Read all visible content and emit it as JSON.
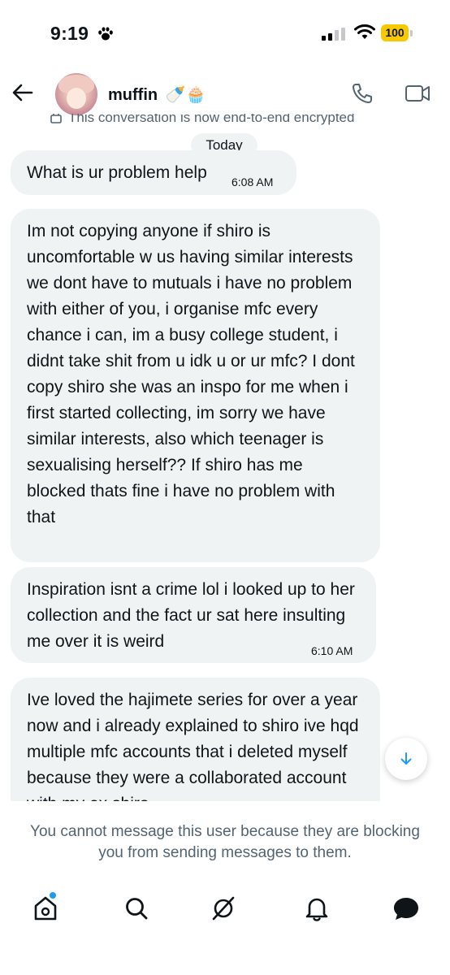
{
  "status_bar": {
    "time": "9:19",
    "battery": "100"
  },
  "header": {
    "username": "muffin",
    "emoji": "🍼🧁"
  },
  "chat": {
    "encryption_notice": "This conversation is now end-to-end encrypted",
    "date_divider": "Today",
    "messages": [
      {
        "text": "What is ur problem help",
        "time": "6:08 AM"
      },
      {
        "text": "Im not copying anyone if shiro is uncomfortable w us having similar interests we dont have to mutuals i have no problem with either of you, i organise mfc every chance i can, im a busy college student, i didnt take shit from u idk u or ur mfc? I dont copy shiro she was an inspo for me when i first started collecting, im sorry we have similar interests, also which teenager is sexualising herself?? If shiro has me blocked thats fine i have no problem with that",
        "time": ""
      },
      {
        "text": "Inspiration isnt a crime lol i looked up to her collection and the fact ur sat here insulting me over it is weird",
        "time": "6:10 AM"
      },
      {
        "text": "Ive loved the hajimete series for over a year now and i already explained to shiro ive hqd multiple mfc accounts that i deleted myself because they were a collaborated account with my ex shiro",
        "time": ""
      }
    ]
  },
  "blocked_notice": "You cannot message this user because they are blocking you from sending messages to them.",
  "colors": {
    "accent": "#1d9bf0",
    "bubble": "#eff3f4",
    "battery": "#f6c900",
    "secondary_text": "#536471"
  },
  "icons": {
    "nav": [
      "home-icon",
      "search-icon",
      "grok-icon",
      "bell-icon",
      "messages-icon"
    ],
    "header": [
      "back-arrow-icon",
      "phone-icon",
      "video-icon"
    ]
  }
}
